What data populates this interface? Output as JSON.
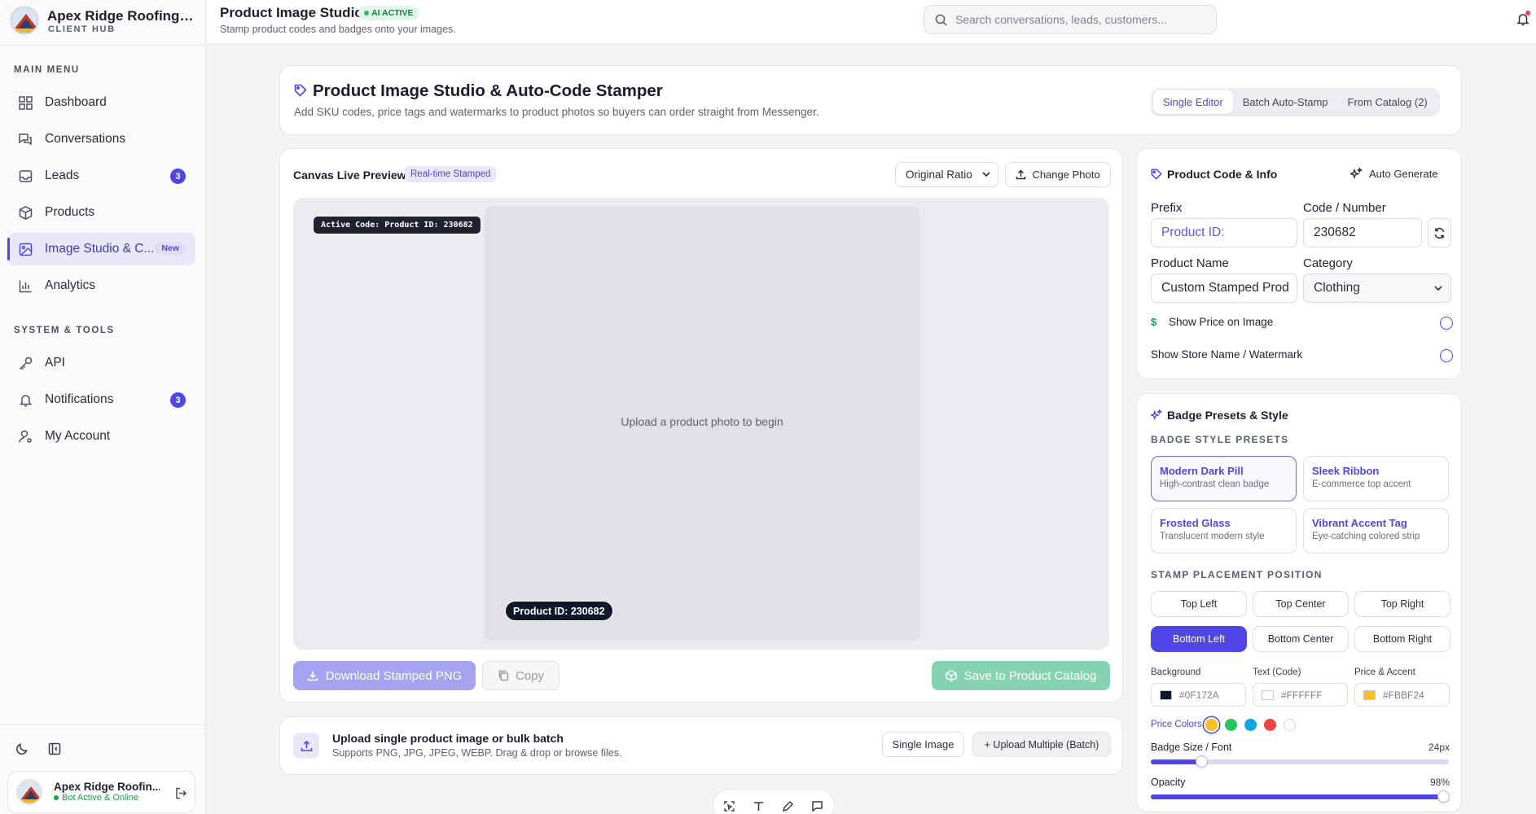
{
  "brand": {
    "name": "Apex Ridge Roofing & ...",
    "sub": "CLIENT HUB"
  },
  "sidebar": {
    "main_label": "MAIN MENU",
    "main_items": [
      {
        "label": "Dashboard",
        "icon": "grid-icon"
      },
      {
        "label": "Conversations",
        "icon": "chat-icon"
      },
      {
        "label": "Leads",
        "icon": "inbox-icon",
        "badge": "3"
      },
      {
        "label": "Products",
        "icon": "box-icon"
      },
      {
        "label": "Image Studio & C...",
        "icon": "image-icon",
        "pill": "New",
        "active": true
      },
      {
        "label": "Analytics",
        "icon": "bar-chart-icon"
      }
    ],
    "system_label": "SYSTEM & TOOLS",
    "system_items": [
      {
        "label": "API",
        "icon": "key-icon"
      },
      {
        "label": "Notifications",
        "icon": "bell-icon",
        "badge": "3"
      },
      {
        "label": "My Account",
        "icon": "user-settings-icon"
      }
    ],
    "user": {
      "name": "Apex Ridge Roofin...",
      "status": "Bot Active & Online",
      "status_color": "#16a34a"
    }
  },
  "header": {
    "title": "Product Image Studio",
    "status": "AI ACTIVE",
    "subtitle": "Stamp product codes and badges onto your images.",
    "search_placeholder": "Search conversations, leads, customers..."
  },
  "studio": {
    "title": "Product Image Studio & Auto-Code Stamper",
    "subtitle": "Add SKU codes, price tags and watermarks to product photos so buyers can order straight from Messenger.",
    "tabs": [
      "Single Editor",
      "Batch Auto-Stamp",
      "From Catalog (2)"
    ]
  },
  "canvas": {
    "title": "Canvas Live Preview",
    "tag": "Real-time Stamped",
    "ratio": "Original Ratio",
    "change_photo": "Change Photo",
    "active_code": "Active Code: Product ID: 230682",
    "placeholder": "Upload a product photo to begin",
    "stamp": "Product ID: 230682",
    "download": "Download Stamped PNG",
    "copy": "Copy",
    "save": "Save to Product Catalog"
  },
  "upload": {
    "title": "Upload single product image or bulk batch",
    "subtitle": "Supports PNG, JPG, JPEG, WEBP. Drag & drop or browse files.",
    "single": "Single Image",
    "multiple": "+ Upload Multiple (Batch)"
  },
  "product_info": {
    "title": "Product Code & Info",
    "auto_generate": "Auto Generate",
    "prefix_label": "Prefix",
    "prefix_value": "Product ID:",
    "code_label": "Code / Number",
    "code_value": "230682",
    "name_label": "Product Name",
    "name_value": "Custom Stamped Prod",
    "category_label": "Category",
    "category_value": "Clothing",
    "show_price": "Show Price on Image",
    "show_store": "Show Store Name / Watermark"
  },
  "badge": {
    "title": "Badge Presets & Style",
    "presets_label": "BADGE STYLE PRESETS",
    "presets": [
      {
        "title": "Modern Dark Pill",
        "desc": "High-contrast clean badge",
        "active": true
      },
      {
        "title": "Sleek Ribbon",
        "desc": "E-commerce top accent"
      },
      {
        "title": "Frosted Glass",
        "desc": "Translucent modern style"
      },
      {
        "title": "Vibrant Accent Tag",
        "desc": "Eye-catching colored strip"
      }
    ],
    "placement_label": "STAMP PLACEMENT POSITION",
    "positions": [
      "Top Left",
      "Top Center",
      "Top Right",
      "Bottom Left",
      "Bottom Center",
      "Bottom Right"
    ],
    "active_position": "Bottom Left",
    "colors": [
      {
        "label": "Background",
        "value": "#0F172A"
      },
      {
        "label": "Text (Code)",
        "value": "#FFFFFF"
      },
      {
        "label": "Price & Accent",
        "value": "#FBBF24"
      }
    ],
    "price_colors_label": "Price Colors",
    "price_colors": [
      "#fbbf24",
      "#22c55e",
      "#0ea5e9",
      "#ef4444",
      "#ffffff"
    ],
    "size_label": "Badge Size / Font",
    "size_value": "24px",
    "size_fraction": 0.17,
    "opacity_label": "Opacity",
    "opacity_value": "98%",
    "opacity_fraction": 0.98
  }
}
